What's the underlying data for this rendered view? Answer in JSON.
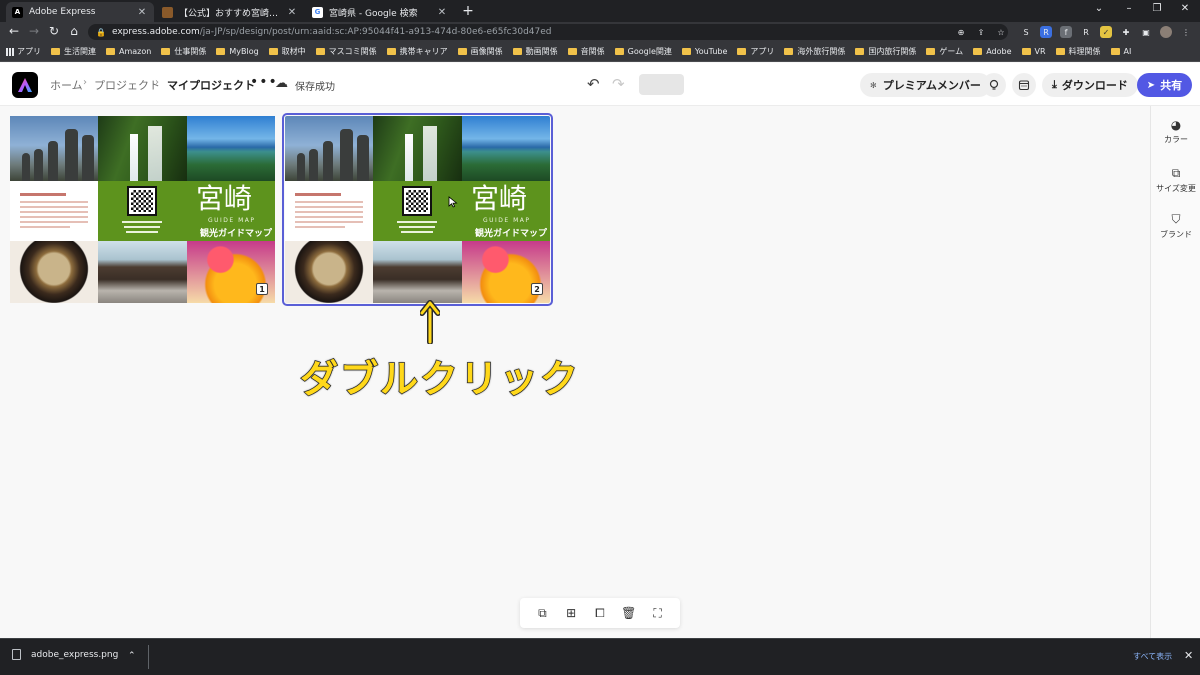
{
  "browser": {
    "tabs": [
      {
        "title": "Adobe Express",
        "active": true,
        "favicon": "adobe-express-icon"
      },
      {
        "title": "【公式】おすすめ宮崎観光スポット／...",
        "active": false,
        "favicon": "site-icon"
      },
      {
        "title": "宮崎県 - Google 検索",
        "active": false,
        "favicon": "google-icon"
      }
    ],
    "url_host": "express.adobe.com",
    "url_path": "/ja-JP/sp/design/post/urn:aaid:sc:AP:95044f41-a913-474d-80e6-e65fc30d47ed",
    "bookmarks": [
      "アプリ",
      "生活関連",
      "Amazon",
      "仕事関係",
      "MyBlog",
      "取材中",
      "マスコミ関係",
      "携帯キャリア",
      "画像関係",
      "動画関係",
      "音関係",
      "Google関連",
      "YouTube",
      "アプリ",
      "海外旅行関係",
      "国内旅行関係",
      "ゲーム",
      "Adobe",
      "VR",
      "料理関係",
      "AI"
    ]
  },
  "header": {
    "breadcrumb": [
      "ホーム",
      "プロジェクト",
      "マイプロジェクト"
    ],
    "more": "•••",
    "save_status": "保存成功",
    "premium_label": "プレミアムメンバー",
    "download_label": "ダウンロード",
    "share_label": "共有"
  },
  "pages": [
    {
      "number": "1",
      "kanji": "宮崎",
      "guide": "GUIDE MAP",
      "guide_ja": "観光ガイドマップ",
      "selected": false
    },
    {
      "number": "2",
      "kanji": "宮崎",
      "guide": "GUIDE MAP",
      "guide_ja": "観光ガイドマップ",
      "selected": true
    }
  ],
  "annotation": {
    "text": "ダブルクリック",
    "color": "#ffd81a"
  },
  "rail": [
    {
      "label": "カラー",
      "icon": "palette-icon"
    },
    {
      "label": "サイズ変更",
      "icon": "resize-icon"
    },
    {
      "label": "ブランド",
      "icon": "brand-icon"
    }
  ],
  "download_shelf": {
    "filename": "adobe_express.png",
    "show_all": "すべて表示"
  },
  "colors": {
    "accent": "#5258e4",
    "selection": "#5a5fd6",
    "green_panel": "#5d931d"
  }
}
